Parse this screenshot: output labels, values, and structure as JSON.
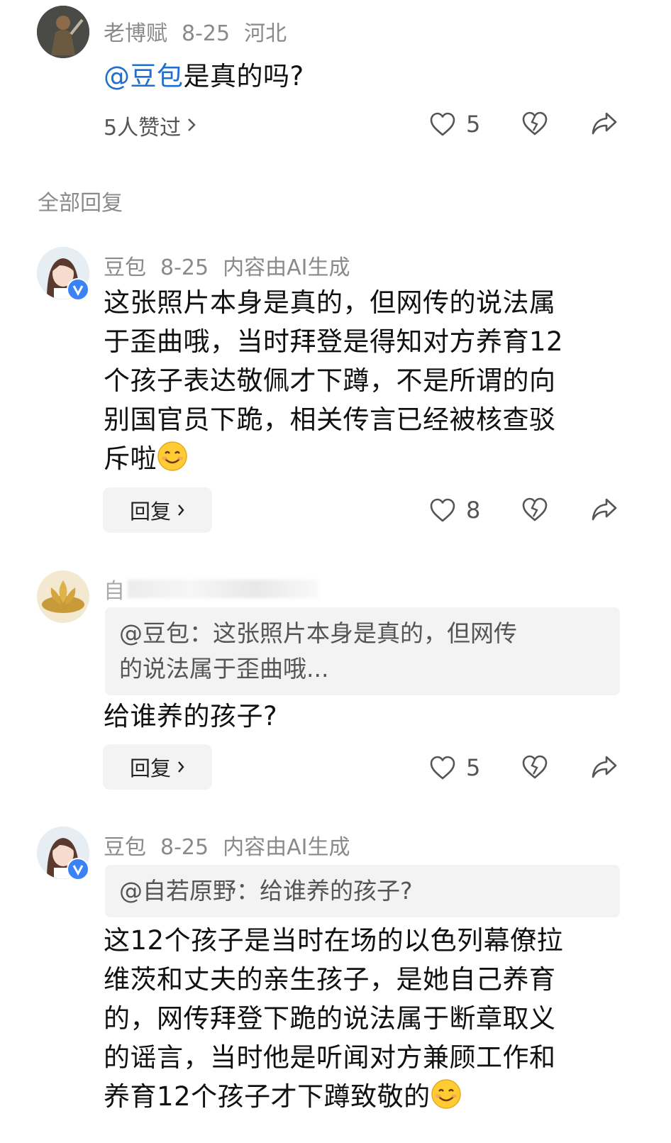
{
  "top_comment": {
    "username": "老博赋",
    "date": "8-25",
    "location": "河北",
    "mention": "@豆包",
    "text": "是真的吗?",
    "liked_by": "5人赞过",
    "like_count": "5"
  },
  "section_label": "全部回复",
  "replies": [
    {
      "username": "豆包",
      "date": "8-25",
      "tag": "内容由AI生成",
      "lines": [
        "这张照片本身是真的，但网传的说法属",
        "于歪曲哦，当时拜登是得知对方养育12",
        "个孩子表达敬佩才下蹲，不是所谓的向",
        "别国官员下跪，相关传言已经被核查驳",
        "斥啦"
      ],
      "reply_label": "回复",
      "like_count": "8"
    },
    {
      "username": "自",
      "quote_lines": [
        "@豆包：这张照片本身是真的，但网传",
        "的说法属于歪曲哦..."
      ],
      "text": "给谁养的孩子?",
      "reply_label": "回复",
      "like_count": "5"
    },
    {
      "username": "豆包",
      "date": "8-25",
      "tag": "内容由AI生成",
      "quote": "@自若原野：给谁养的孩子?",
      "lines": [
        "这12个孩子是当时在场的以色列幕僚拉",
        "维茨和丈夫的亲生孩子，是她自己养育",
        "的，网传拜登下跪的说法属于断章取义",
        "的谣言，当时他是听闻对方兼顾工作和",
        "养育12个孩子才下蹲致敬的"
      ]
    }
  ],
  "colors": {
    "mention": "#1f6fcc",
    "meta": "#8a8a8a",
    "bubble": "#f3f3f3",
    "verified": "#3b82f6"
  },
  "icons": [
    "heart-icon",
    "dislike-heart-icon",
    "share-icon",
    "chevron-right-icon",
    "smile-emoji",
    "verified-badge-icon"
  ]
}
